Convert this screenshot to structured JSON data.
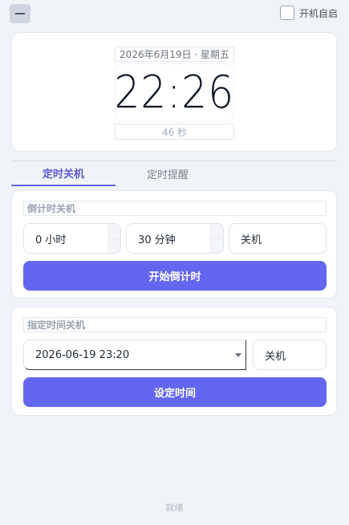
{
  "topbar": {
    "minimize_icon": "minimize-icon",
    "autostart_label": "开机自启",
    "autostart_checked": false
  },
  "clock": {
    "date": "2026年6月19日 · 星期五",
    "time": "22:26",
    "seconds": "46 秒"
  },
  "tabs": [
    {
      "label": "定时关机",
      "active": true
    },
    {
      "label": "定时提醒",
      "active": false
    }
  ],
  "countdown": {
    "title": "倒计时关机",
    "hours_value": "0 小时",
    "minutes_value": "30 分钟",
    "action_value": "关机",
    "start_label": "开始倒计时"
  },
  "scheduled": {
    "title": "指定时间关机",
    "datetime_value": "2026-06-19  23:20",
    "action_value": "关机",
    "set_label": "设定时间"
  },
  "status": {
    "text": "就绪"
  },
  "colors": {
    "accent": "#6366f1",
    "background": "#f0f3f8",
    "card": "#ffffff"
  }
}
